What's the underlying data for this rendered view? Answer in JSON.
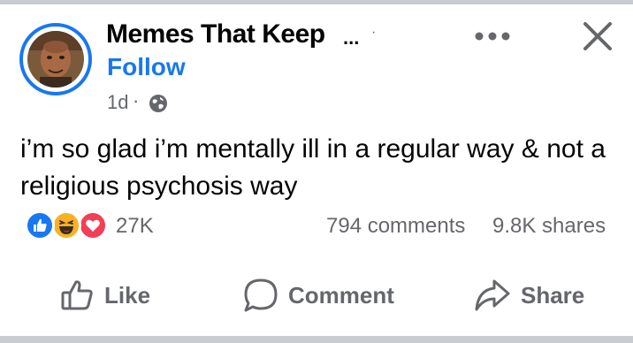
{
  "post": {
    "page_name": "Memes That Keep",
    "name_ellipsis": "...",
    "name_dot": "·",
    "follow_label": "Follow",
    "timestamp": "1d",
    "meta_separator": "·",
    "privacy_icon": "globe-icon",
    "text": "i’m so glad i’m mentally ill in a regular way & not a religious psychosis way"
  },
  "stats": {
    "reaction_icons": [
      "like-reaction-icon",
      "haha-reaction-icon",
      "love-reaction-icon"
    ],
    "reaction_count": "27K",
    "comments": "794 comments",
    "shares": "9.8K shares"
  },
  "actions": {
    "like_label": "Like",
    "comment_label": "Comment",
    "share_label": "Share"
  },
  "colors": {
    "accent": "#1877f2",
    "secondary_text": "#65676b",
    "primary_text": "#050505",
    "love": "#f33e58",
    "haha": "#f7b125",
    "divider": "#c9ccd1"
  }
}
